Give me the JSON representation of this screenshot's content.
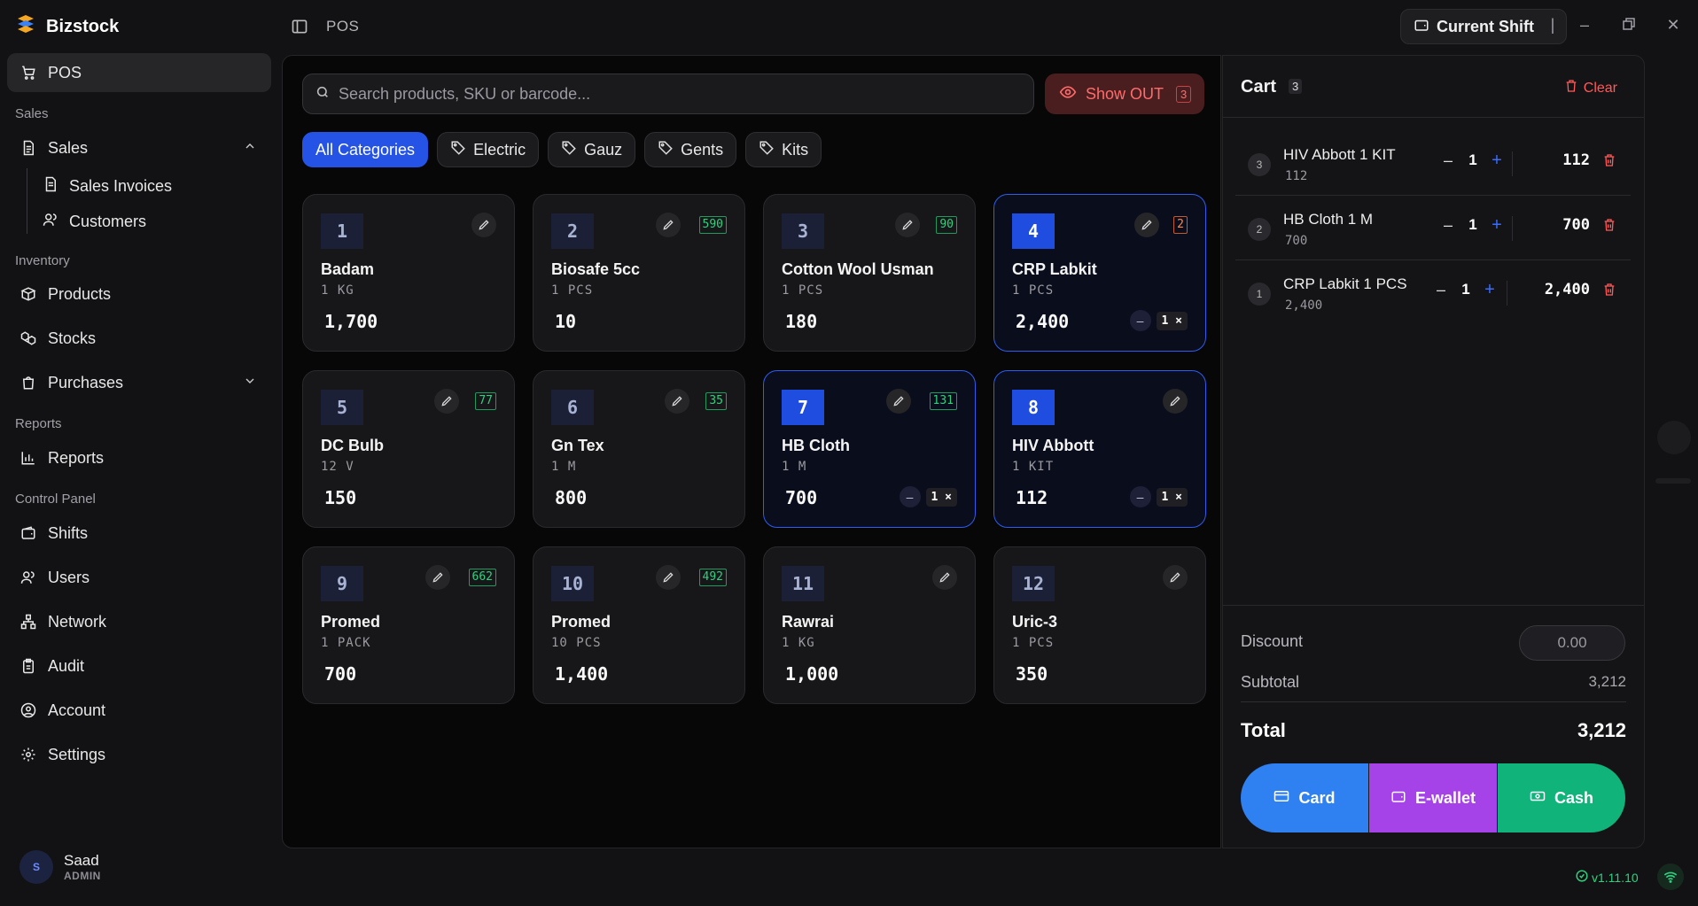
{
  "app": {
    "name": "Bizstock"
  },
  "topbar": {
    "title": "POS",
    "shift_label": "Current Shift"
  },
  "sidebar": {
    "pos": "POS",
    "section_sales": "Sales",
    "sales": "Sales",
    "sales_invoices": "Sales Invoices",
    "customers": "Customers",
    "section_inventory": "Inventory",
    "products": "Products",
    "stocks": "Stocks",
    "purchases": "Purchases",
    "section_reports": "Reports",
    "reports": "Reports",
    "section_control": "Control Panel",
    "shifts": "Shifts",
    "users": "Users",
    "network": "Network",
    "audit": "Audit",
    "account": "Account",
    "settings": "Settings"
  },
  "user": {
    "initial": "S",
    "name": "Saad",
    "role": "ADMIN"
  },
  "search": {
    "placeholder": "Search products, SKU or barcode..."
  },
  "showout": {
    "label": "Show OUT",
    "count": "3"
  },
  "categories": [
    "All Categories",
    "Electric",
    "Gauz",
    "Gents",
    "Kits"
  ],
  "products": [
    {
      "num": "1",
      "name": "Badam",
      "unit": "1 KG",
      "price": "1,700",
      "stock": "",
      "selected": false,
      "qty": ""
    },
    {
      "num": "2",
      "name": "Biosafe 5cc",
      "unit": "1 PCS",
      "price": "10",
      "stock": "590",
      "selected": false,
      "qty": ""
    },
    {
      "num": "3",
      "name": "Cotton Wool Usman",
      "unit": "1 PCS",
      "price": "180",
      "stock": "90",
      "selected": false,
      "qty": ""
    },
    {
      "num": "4",
      "name": "CRP Labkit",
      "unit": "1 PCS",
      "price": "2,400",
      "stock": "2",
      "low": true,
      "selected": true,
      "qty": "1 ×"
    },
    {
      "num": "5",
      "name": "DC Bulb",
      "unit": "12 V",
      "price": "150",
      "stock": "77",
      "selected": false,
      "qty": ""
    },
    {
      "num": "6",
      "name": "Gn Tex",
      "unit": "1 M",
      "price": "800",
      "stock": "35",
      "selected": false,
      "qty": ""
    },
    {
      "num": "7",
      "name": "HB Cloth",
      "unit": "1 M",
      "price": "700",
      "stock": "131",
      "selected": true,
      "qty": "1 ×"
    },
    {
      "num": "8",
      "name": "HIV Abbott",
      "unit": "1 KIT",
      "price": "112",
      "stock": "",
      "selected": true,
      "qty": "1 ×"
    },
    {
      "num": "9",
      "name": "Promed",
      "unit": "1 PACK",
      "price": "700",
      "stock": "662",
      "selected": false,
      "qty": ""
    },
    {
      "num": "10",
      "name": "Promed",
      "unit": "10 PCS",
      "price": "1,400",
      "stock": "492",
      "selected": false,
      "qty": ""
    },
    {
      "num": "11",
      "name": "Rawrai",
      "unit": "1 KG",
      "price": "1,000",
      "stock": "",
      "selected": false,
      "qty": ""
    },
    {
      "num": "12",
      "name": "Uric-3",
      "unit": "1 PCS",
      "price": "350",
      "stock": "",
      "selected": false,
      "qty": ""
    }
  ],
  "cart": {
    "title": "Cart",
    "count": "3",
    "clear_label": "Clear",
    "items": [
      {
        "idx": "3",
        "name": "HIV Abbott 1 KIT",
        "unit_price": "112",
        "qty": "1",
        "total": "112"
      },
      {
        "idx": "2",
        "name": "HB Cloth 1 M",
        "unit_price": "700",
        "qty": "1",
        "total": "700"
      },
      {
        "idx": "1",
        "name": "CRP Labkit 1 PCS",
        "unit_price": "2,400",
        "qty": "1",
        "total": "2,400"
      }
    ],
    "discount_label": "Discount",
    "discount_value": "0.00",
    "subtotal_label": "Subtotal",
    "subtotal_value": "3,212",
    "total_label": "Total",
    "total_value": "3,212",
    "pay_card": "Card",
    "pay_ewallet": "E-wallet",
    "pay_cash": "Cash"
  },
  "version": "v1.11.10",
  "colors": {
    "accent": "#2553e6",
    "danger": "#ff5a5a",
    "success": "#2fd17f",
    "card_pay": "#2f80f0",
    "ewallet_pay": "#a542e8",
    "cash_pay": "#10b37a"
  }
}
